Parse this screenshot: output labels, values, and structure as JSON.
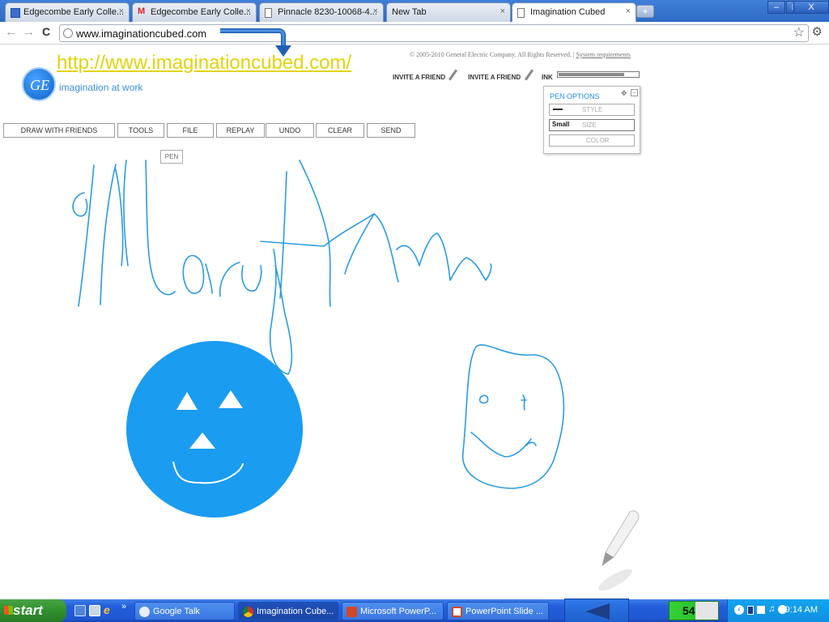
{
  "browser": {
    "tabs": [
      {
        "label": "Edgecombe Early Colle...",
        "icon": "calendar-icon",
        "active": false
      },
      {
        "label": "Edgecombe Early Colle...",
        "icon": "gmail-icon",
        "active": false
      },
      {
        "label": "Pinnacle 8230-10068-4...",
        "icon": "page-icon",
        "active": false
      },
      {
        "label": "New Tab",
        "icon": "",
        "active": false
      },
      {
        "label": "Imagination Cubed",
        "icon": "page-icon",
        "active": true
      }
    ],
    "new_tab": "+",
    "window_controls": {
      "minimize": "–",
      "maximize": "□",
      "close": "X"
    },
    "address": "www.imaginationcubed.com",
    "nav": {
      "back": "←",
      "forward": "→",
      "reload": "C"
    },
    "star": "☆",
    "wrench": "🔧"
  },
  "page": {
    "annotation_url": "http://www.imaginationcubed.com/",
    "copyright": "© 2005-2010 General Electric Company. All Rights Reserved. |",
    "system_requirements": "System requirements",
    "logo_text": "GE",
    "tagline": "imagination at work",
    "invite_1": "INVITE A FRIEND",
    "invite_2": "INVITE A FRIEND",
    "ink_label": "INK",
    "ink_level": 0.83,
    "menu": [
      "DRAW WITH FRIENDS",
      "TOOLS",
      "FILE",
      "REPLAY",
      "UNDO",
      "CLEAR",
      "SEND"
    ],
    "pen_tip": "PEN",
    "pen_options": {
      "title": "PEN OPTIONS",
      "style_label": "STYLE",
      "size_label": "SIZE",
      "size_value": "Small",
      "color_label": "COLOR"
    },
    "stroke_color": "#2b9be0",
    "fill_color": "#1a9cf0"
  },
  "taskbar": {
    "start": "start",
    "overflow": "»",
    "tasks": [
      {
        "label": "Google Talk",
        "icon": "chat-icon",
        "active": false
      },
      {
        "label": "Imagination Cube...",
        "icon": "chrome-icon",
        "active": true
      },
      {
        "label": "Microsoft PowerP...",
        "icon": "powerpoint-icon",
        "active": false
      },
      {
        "label": "PowerPoint Slide ...",
        "icon": "powerpoint-icon",
        "active": false
      }
    ],
    "battery": "54%",
    "battery_level": 0.54,
    "clock": "9:14 AM"
  }
}
